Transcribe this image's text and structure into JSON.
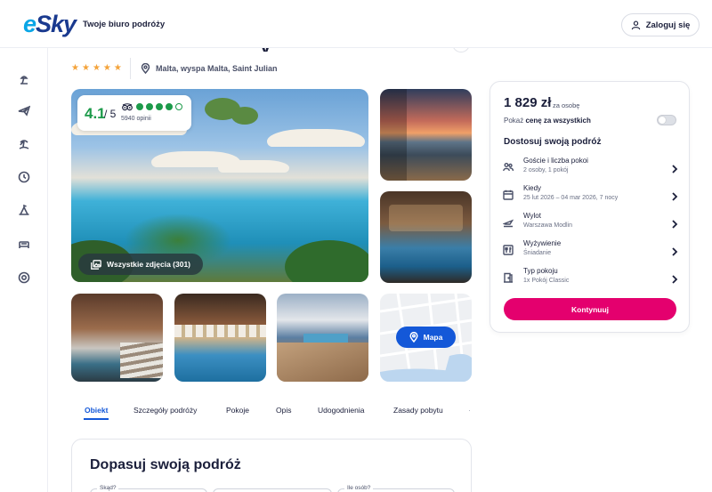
{
  "header": {
    "logo": "eSky",
    "tagline": "Twoje biuro podróży",
    "login_label": "Zaloguj się"
  },
  "rail": {
    "items": [
      "beach-icon",
      "plane-icon",
      "palm-island-icon",
      "clock-icon",
      "camping-icon",
      "bed-icon",
      "help-icon"
    ]
  },
  "hotel": {
    "title_fragment": "y",
    "stars": 5,
    "location": "Malta, wyspa Malta, Saint Julian"
  },
  "rating": {
    "score": "4.1",
    "of": "/ 5",
    "bubbles_filled": 4,
    "reviews": "5940 opinii"
  },
  "photos": {
    "all_photos_label": "Wszystkie zdjęcia (301)",
    "map_label": "Mapa"
  },
  "tabs": [
    {
      "label": "Obiekt",
      "active": true
    },
    {
      "label": "Szczegóły podróży",
      "active": false
    },
    {
      "label": "Pokoje",
      "active": false
    },
    {
      "label": "Opis",
      "active": false
    },
    {
      "label": "Udogodnienia",
      "active": false
    },
    {
      "label": "Zasady pobytu",
      "active": false
    }
  ],
  "adjust": {
    "title": "Dopasuj swoją podróż",
    "field_from": "Skąd?",
    "field_people": "Ile osób?"
  },
  "booking": {
    "price": "1 829 zł",
    "per_person": "za osobę",
    "show_price_prefix": "Pokaż",
    "show_price_bold": "cenę za wszystkich",
    "adjust_title": "Dostosuj swoją podróż",
    "options": [
      {
        "icon": "guests-icon",
        "title": "Goście i liczba pokoi",
        "sub": "2 osoby, 1 pokój"
      },
      {
        "icon": "calendar-icon",
        "title": "Kiedy",
        "sub": "25 lut 2026 – 04 mar 2026, 7 nocy"
      },
      {
        "icon": "departure-icon",
        "title": "Wylot",
        "sub": "Warszawa Modlin"
      },
      {
        "icon": "meal-icon",
        "title": "Wyżywienie",
        "sub": "Śniadanie"
      },
      {
        "icon": "room-icon",
        "title": "Typ pokoju",
        "sub": "1x Pokój Classic"
      }
    ],
    "continue_label": "Kontynuuj"
  },
  "colors": {
    "brand_blue": "#1458d8",
    "cta_pink": "#e4006e",
    "rating_green": "#1c9a4a",
    "star_orange": "#f4a33a"
  }
}
